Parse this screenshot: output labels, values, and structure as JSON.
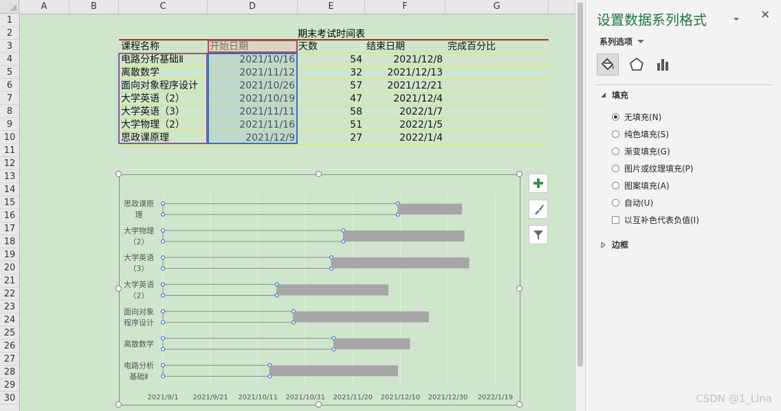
{
  "sheet": {
    "columns": [
      "A",
      "B",
      "C",
      "D",
      "E",
      "F",
      "G"
    ],
    "rows": [
      "1",
      "2",
      "3",
      "4",
      "5",
      "6",
      "7",
      "8",
      "9",
      "10",
      "11",
      "12",
      "13",
      "14",
      "15",
      "16",
      "17",
      "18",
      "19",
      "20",
      "21",
      "22",
      "23",
      "24",
      "25",
      "26",
      "27",
      "28",
      "29",
      "30"
    ],
    "table_title": "期末考试时间表",
    "headers": {
      "course": "课程名称",
      "start": "开始日期",
      "days": "天数",
      "end": "结束日期",
      "pct": "完成百分比"
    },
    "records": [
      {
        "course": "电路分析基础Ⅱ",
        "start": "2021/10/16",
        "days": "54",
        "end": "2021/12/8"
      },
      {
        "course": "离散数学",
        "start": "2021/11/12",
        "days": "32",
        "end": "2021/12/13"
      },
      {
        "course": "面向对象程序设计",
        "start": "2021/10/26",
        "days": "57",
        "end": "2021/12/21"
      },
      {
        "course": "大学英语（2）",
        "start": "2021/10/19",
        "days": "47",
        "end": "2021/12/4"
      },
      {
        "course": "大学英语（3）",
        "start": "2021/11/11",
        "days": "58",
        "end": "2022/1/7"
      },
      {
        "course": "大学物理（2）",
        "start": "2021/11/16",
        "days": "51",
        "end": "2022/1/5"
      },
      {
        "course": "思政课原理",
        "start": "2021/12/9",
        "days": "27",
        "end": "2022/1/4"
      }
    ]
  },
  "chart_data": {
    "type": "bar",
    "orientation": "horizontal-stacked",
    "categories": [
      [
        "思政课原",
        "理"
      ],
      [
        "大学物理",
        "（2）"
      ],
      [
        "大学英语",
        "（3）"
      ],
      [
        "大学英语",
        "（2）"
      ],
      [
        "面向对象",
        "程序设计"
      ],
      [
        "离散数学"
      ],
      [
        "电路分析",
        "基础Ⅱ"
      ]
    ],
    "series": [
      {
        "name": "开始日期",
        "start": [
          "2021/12/9",
          "2021/11/16",
          "2021/11/11",
          "2021/10/19",
          "2021/10/26",
          "2021/11/12",
          "2021/10/16"
        ],
        "fill": "none",
        "selected": true
      },
      {
        "name": "天数",
        "values": [
          27,
          51,
          58,
          47,
          57,
          32,
          54
        ],
        "color": "#a6a6a6"
      }
    ],
    "x_tick_labels": [
      "2021/9/1",
      "2021/9/21",
      "2021/10/11",
      "2021/10/31",
      "2021/11/20",
      "2021/12/10",
      "2021/12/30",
      "2022/1/19"
    ],
    "x_min": "2021/9/1",
    "x_max": "2022/1/29"
  },
  "chart_buttons": {
    "add": "chart-elements-icon",
    "style": "brush-icon",
    "filter": "filter-icon"
  },
  "pane": {
    "title": "设置数据系列格式",
    "section": "系列选项",
    "fill_header": "填充",
    "options": [
      "无填充(N)",
      "纯色填充(S)",
      "渐变填充(G)",
      "图片或纹理填充(P)",
      "图案填充(A)",
      "自动(U)"
    ],
    "invert_label": "以互补色代表负值(I)",
    "border_header": "边框"
  },
  "watermark": "CSDN @1_Lina",
  "colors": {
    "accent": "#217346",
    "bar": "#a6a6a6",
    "sheet_bg": "#cfe6cc"
  }
}
